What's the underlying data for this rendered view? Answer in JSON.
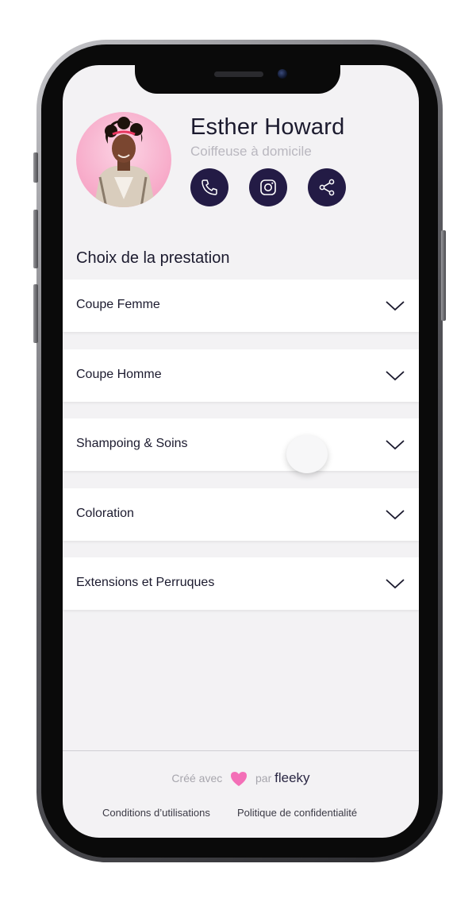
{
  "profile": {
    "name": "Esther Howard",
    "subtitle": "Coiffeuse à domicile"
  },
  "actions": [
    {
      "icon": "phone-icon"
    },
    {
      "icon": "instagram-icon"
    },
    {
      "icon": "share-icon"
    }
  ],
  "section": {
    "title": "Choix de la prestation"
  },
  "services": [
    {
      "label": "Coupe Femme"
    },
    {
      "label": "Coupe Homme"
    },
    {
      "label": "Shampoing & Soins"
    },
    {
      "label": "Coloration"
    },
    {
      "label": "Extensions et Perruques"
    }
  ],
  "footer": {
    "made_with_prefix": "Créé avec",
    "made_with_by": "par",
    "brand": "fleeky",
    "terms": "Conditions d’utilisations",
    "privacy": "Politique de confidentialité"
  },
  "colors": {
    "accent": "#231b45",
    "heart": "#f36fb7",
    "screen_bg": "#f3f2f4"
  }
}
